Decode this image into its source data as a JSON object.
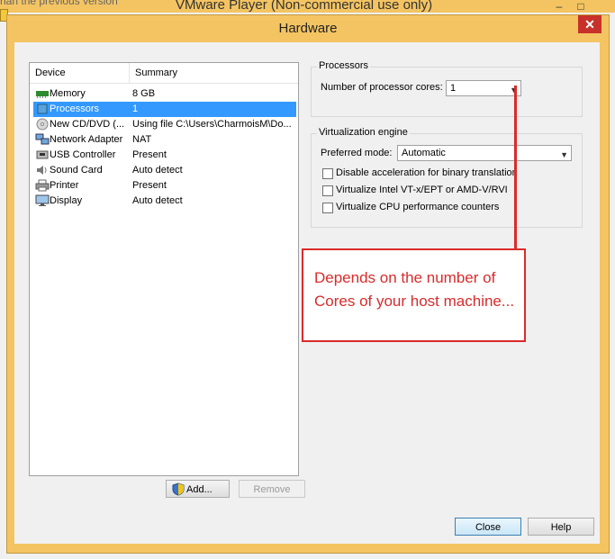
{
  "background": {
    "top_text": "nan the previous version",
    "title": "VMware Player (Non-commercial use only)"
  },
  "dialog": {
    "title": "Hardware",
    "close_glyph": "✕"
  },
  "device_list": {
    "columns": [
      "Device",
      "Summary"
    ],
    "rows": [
      {
        "device": "Memory",
        "summary": "8 GB",
        "icon": "memory-icon"
      },
      {
        "device": "Processors",
        "summary": "1",
        "icon": "processor-icon",
        "selected": true
      },
      {
        "device": "New CD/DVD (...",
        "summary": "Using file C:\\Users\\CharmoisM\\Do...",
        "icon": "cd-dvd-icon"
      },
      {
        "device": "Network Adapter",
        "summary": "NAT",
        "icon": "network-icon"
      },
      {
        "device": "USB Controller",
        "summary": "Present",
        "icon": "usb-icon"
      },
      {
        "device": "Sound Card",
        "summary": "Auto detect",
        "icon": "sound-icon"
      },
      {
        "device": "Printer",
        "summary": "Present",
        "icon": "printer-icon"
      },
      {
        "device": "Display",
        "summary": "Auto detect",
        "icon": "display-icon"
      }
    ]
  },
  "buttons": {
    "add": "Add...",
    "remove": "Remove",
    "close": "Close",
    "help": "Help"
  },
  "processors": {
    "group_title": "Processors",
    "cores_label": "Number of processor cores:",
    "cores_value": "1"
  },
  "virtualization": {
    "group_title": "Virtualization engine",
    "mode_label": "Preferred mode:",
    "mode_value": "Automatic",
    "options": [
      {
        "label": "Disable acceleration for binary translation",
        "checked": false
      },
      {
        "label": "Virtualize Intel VT-x/EPT or AMD-V/RVI",
        "checked": false
      },
      {
        "label": "Virtualize CPU performance counters",
        "checked": false
      }
    ]
  },
  "annotation": {
    "text": "Depends on the number of Cores of your host machine...",
    "color": "#d92b2b"
  }
}
